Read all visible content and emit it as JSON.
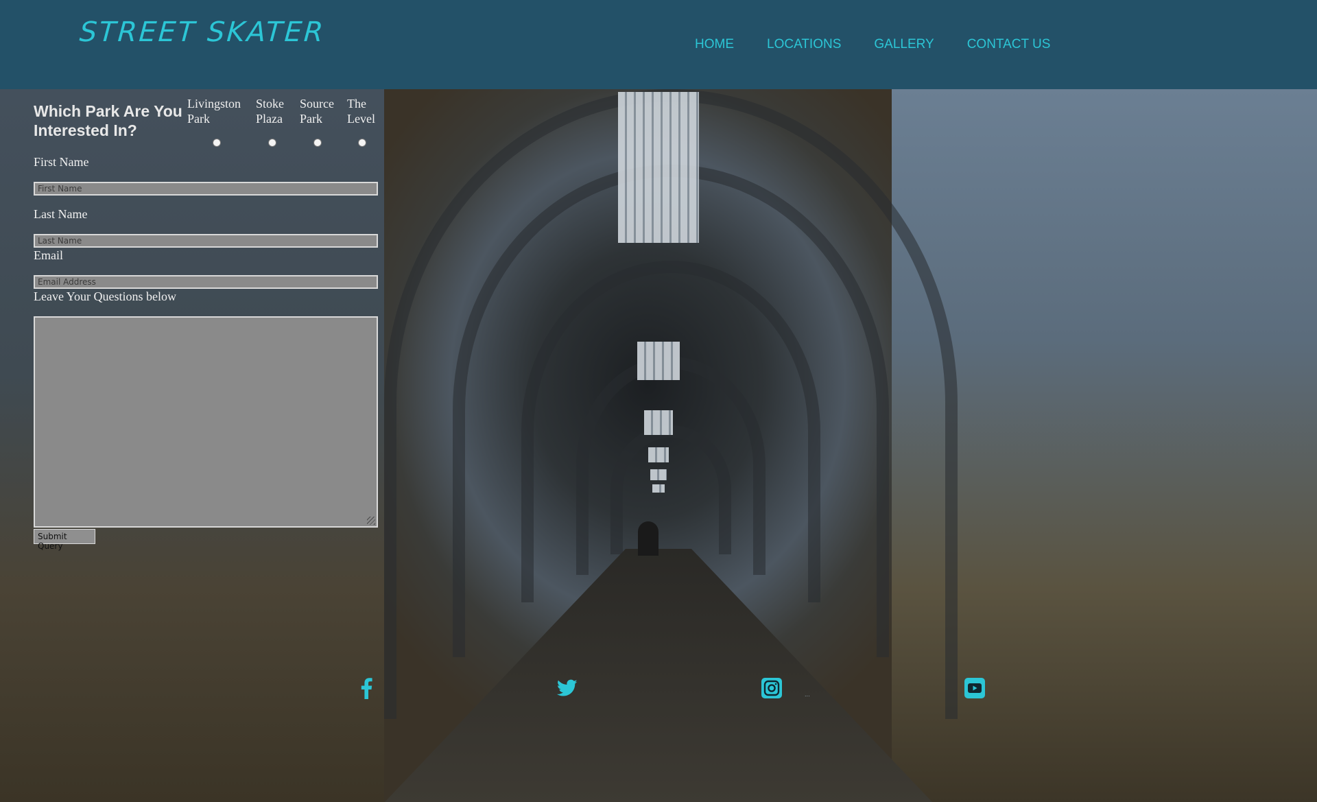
{
  "brand": {
    "logo": "STREET SKATER",
    "accent_color": "#2cc6d6",
    "header_color": "#235168"
  },
  "nav": {
    "items": [
      "HOME",
      "LOCATIONS",
      "GALLERY",
      "CONTACT US"
    ]
  },
  "form": {
    "park_question": "Which Park Are You Interested In?",
    "parks": [
      {
        "line1": "Livingston",
        "line2": "Park"
      },
      {
        "line1": "Stoke",
        "line2": "Plaza"
      },
      {
        "line1": "Source",
        "line2": "Park"
      },
      {
        "line1": "The",
        "line2": "Level"
      }
    ],
    "first_name_label": "First Name",
    "first_name_placeholder": "First Name",
    "last_name_label": "Last Name",
    "last_name_placeholder": "Last Name",
    "email_label": "Email",
    "email_placeholder": "Email Address",
    "questions_label": "Leave Your Questions below",
    "questions_value": "",
    "submit_label": "Submit Query"
  },
  "social": {
    "icons": [
      "facebook-icon",
      "twitter-icon",
      "instagram-icon",
      "youtube-icon"
    ],
    "stray_text": "..."
  }
}
